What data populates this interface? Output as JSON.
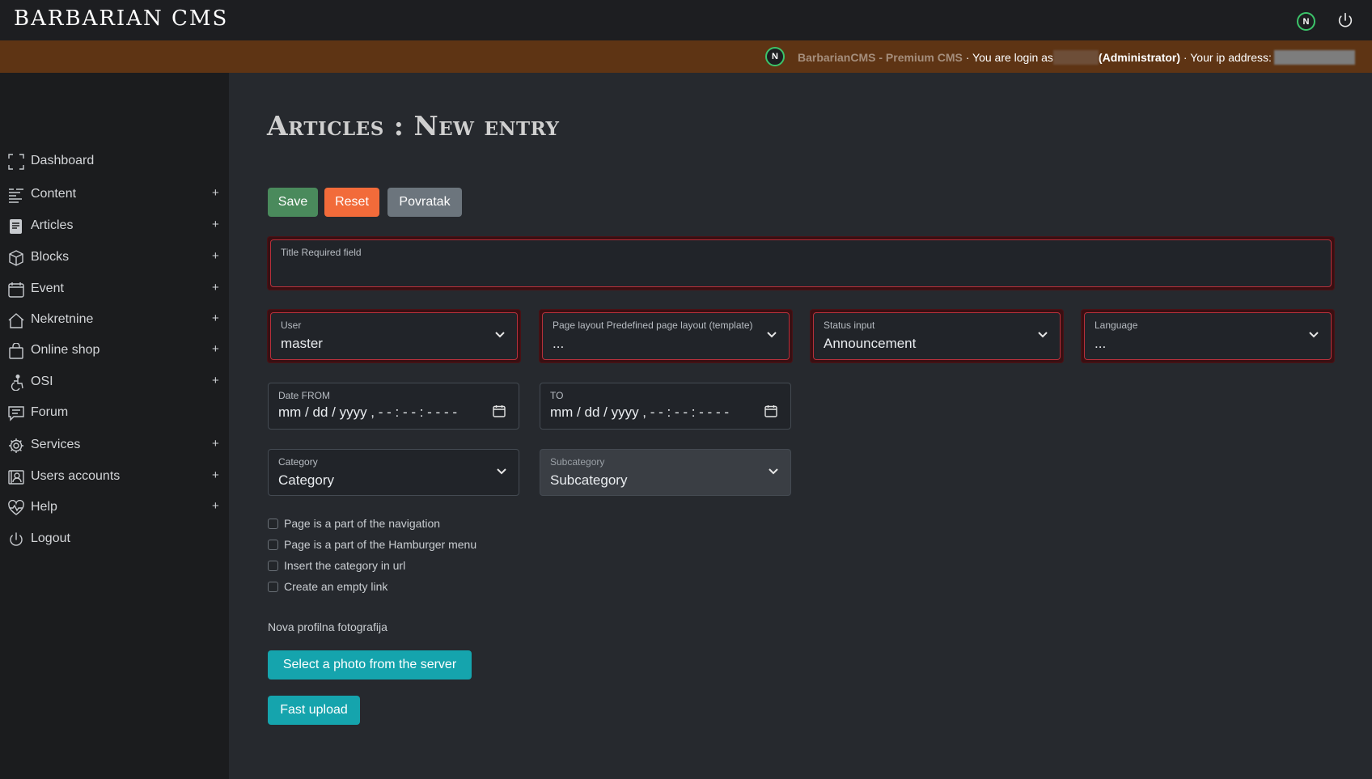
{
  "app": {
    "brand": "BARBARIAN CMS",
    "top_badge": "N"
  },
  "infobar": {
    "badge": "N",
    "product": "BarbarianCMS - Premium CMS",
    "login_prefix": " · You are login as",
    "role": "(Administrator)",
    "ip_prefix": " · Your ip address:"
  },
  "sidebar": {
    "items": [
      {
        "label": "Dashboard",
        "icon": "dashboard-icon",
        "expand": ""
      },
      {
        "label": "Content",
        "icon": "content-icon",
        "expand": "+"
      },
      {
        "label": "Articles",
        "icon": "articles-icon",
        "expand": "+"
      },
      {
        "label": "Blocks",
        "icon": "blocks-icon",
        "expand": "+"
      },
      {
        "label": "Event",
        "icon": "calendar-icon",
        "expand": "+"
      },
      {
        "label": "Nekretnine",
        "icon": "house-icon",
        "expand": "+"
      },
      {
        "label": "Online shop",
        "icon": "shopping-bag-icon",
        "expand": "+"
      },
      {
        "label": "OSI",
        "icon": "accessibility-icon",
        "expand": "+"
      },
      {
        "label": "Forum",
        "icon": "forum-icon",
        "expand": ""
      },
      {
        "label": "Services",
        "icon": "gear-icon",
        "expand": "+"
      },
      {
        "label": "Users accounts",
        "icon": "users-icon",
        "expand": "+"
      },
      {
        "label": "Help",
        "icon": "heart-pulse-icon",
        "expand": "+"
      },
      {
        "label": "Logout",
        "icon": "power-icon",
        "expand": ""
      }
    ]
  },
  "main": {
    "title": "Articles : New entry",
    "buttons": {
      "save": "Save",
      "reset": "Reset",
      "back": "Povratak"
    },
    "title_field": {
      "label": "Title Required field",
      "value": ""
    },
    "user": {
      "label": "User",
      "value": "master"
    },
    "page_layout": {
      "label": "Page layout Predefined page layout (template)",
      "value": "..."
    },
    "status": {
      "label": "Status input",
      "value": "Announcement"
    },
    "language": {
      "label": "Language",
      "value": "..."
    },
    "date_from": {
      "label": "Date FROM",
      "placeholder": "mm / dd / yyyy ,  - - : - - : - -   - -"
    },
    "date_to": {
      "label": "TO",
      "placeholder": "mm / dd / yyyy ,  - - : - - : - -   - -"
    },
    "category": {
      "label": "Category",
      "value": "Category"
    },
    "subcategory": {
      "label": "Subcategory",
      "value": "Subcategory"
    },
    "checkboxes": [
      "Page is a part of the navigation",
      "Page is a part of the Hamburger menu",
      "Insert the category in url",
      "Create an empty link"
    ],
    "photo_label": "Nova profilna fotografija",
    "select_photo": "Select a photo from the server",
    "fast_upload": "Fast upload"
  },
  "colors": {
    "save": "#4a8a5c",
    "reset": "#f26b3a",
    "back": "#6c757d",
    "teal": "#15a4ad",
    "infobar": "#5e3414",
    "invalid": "#b5303b"
  }
}
